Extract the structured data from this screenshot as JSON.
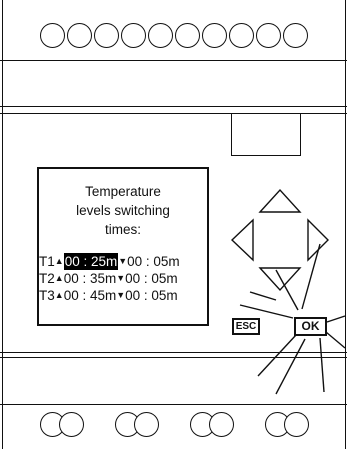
{
  "screen": {
    "title_lines": [
      "Temperature",
      "levels switching",
      "times:"
    ],
    "rows": [
      {
        "label": "T1",
        "up_icon": "triangle-up",
        "up_value": "00 : 25m",
        "down_icon": "triangle-down",
        "down_value": "00 : 05m",
        "selected": true
      },
      {
        "label": "T2",
        "up_icon": "triangle-up",
        "up_value": "00 : 35m",
        "down_icon": "triangle-down",
        "down_value": "00 : 05m",
        "selected": false
      },
      {
        "label": "T3",
        "up_icon": "triangle-up",
        "up_value": "00 : 45m",
        "down_icon": "triangle-down",
        "down_value": "00 : 05m",
        "selected": false
      }
    ]
  },
  "buttons": {
    "esc_label": "ESC",
    "ok_label": "OK",
    "nav_icons": [
      "arrow-up-icon",
      "arrow-left-icon",
      "arrow-right-icon",
      "arrow-down-icon"
    ]
  },
  "terminals": {
    "top_count": 10,
    "bottom_groups": 4
  },
  "colors": {
    "line": "#111111",
    "background": "#ffffff",
    "highlight": "#000000"
  }
}
